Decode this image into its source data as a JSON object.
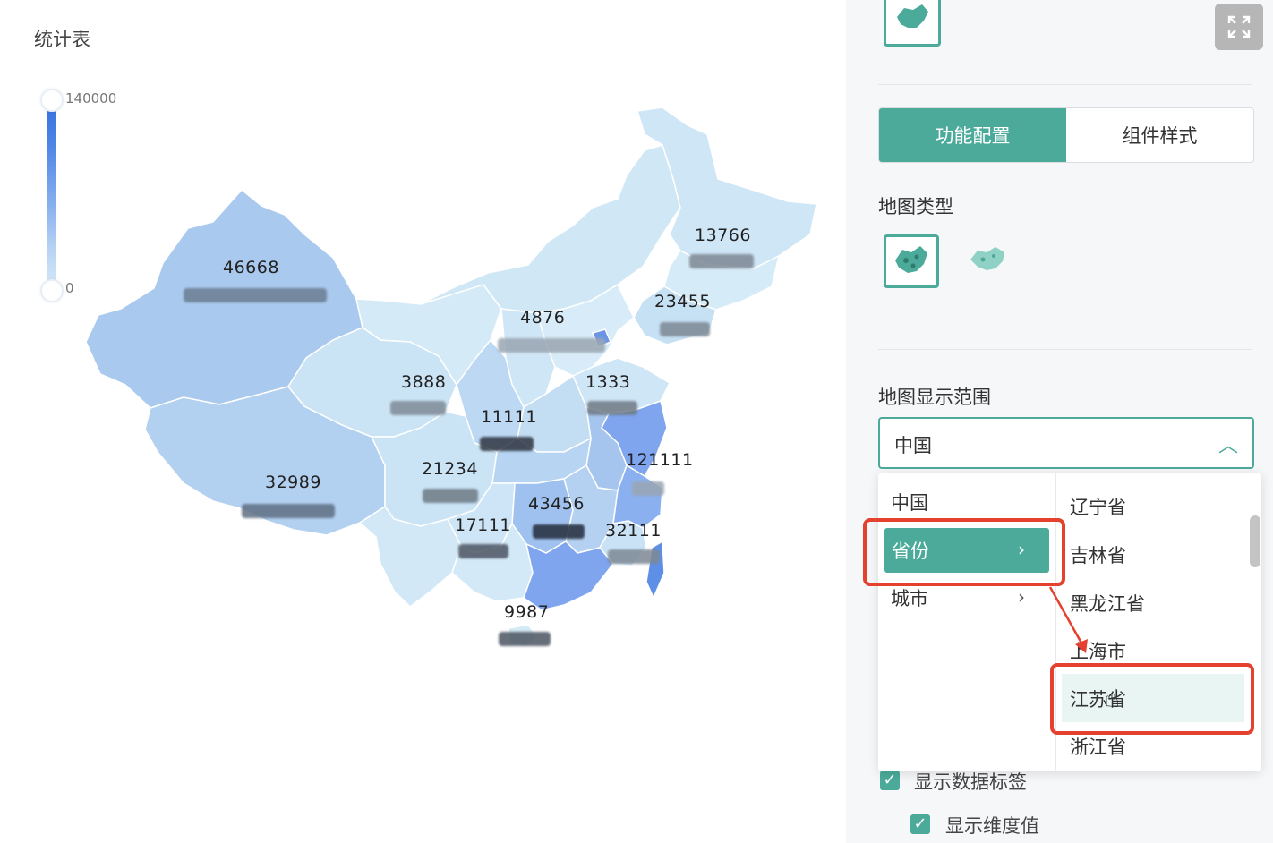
{
  "chart": {
    "title": "统计表",
    "legend": {
      "max": "140000",
      "min": "0"
    },
    "labels": {
      "xinjiang": "46668",
      "tibet": "32989",
      "heilongjiang": "13766",
      "liaoning": "23455",
      "beijing": "4876",
      "gansu": "3888",
      "shandong": "1333",
      "shaanxi": "11111",
      "jiangsu": "121111",
      "sichuan": "21234",
      "hunan": "43456",
      "guizhou": "17111",
      "fujian": "32111",
      "guangdong": "9987"
    },
    "colors": {
      "lightest": "#d4eaf6",
      "light": "#c3ddf3",
      "mid": "#a9c9ee",
      "midblue": "#99bbf0",
      "strong": "#7ea5ee",
      "deep": "#5e8fe6"
    }
  },
  "panel": {
    "tabs": [
      "功能配置",
      "组件样式"
    ],
    "map_type_label": "地图类型",
    "map_range_label": "地图显示范围",
    "map_range_value": "中国",
    "dropdown": {
      "left": [
        "中国",
        "省份",
        "城市"
      ],
      "right": [
        "辽宁省",
        "吉林省",
        "黑龙江省",
        "上海市",
        "江苏省",
        "浙江省"
      ]
    },
    "checks": [
      "显示数据标签",
      "显示维度值"
    ],
    "accent": "#4baa9a",
    "highlight": "#e4412f"
  }
}
